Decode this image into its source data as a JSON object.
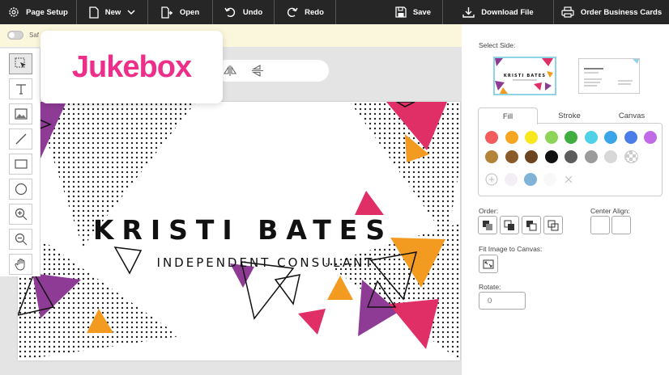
{
  "toolbar": {
    "page_setup": "Page Setup",
    "new": "New",
    "open": "Open",
    "undo": "Undo",
    "redo": "Redo",
    "save": "Save",
    "download": "Download File",
    "order": "Order Business Cards"
  },
  "safe_toggle_label": "Saf",
  "logo": "Jukebox",
  "card": {
    "name": "KRISTI BATES",
    "title": "INDEPENDENT CONSULANT"
  },
  "panel": {
    "select_side": "Select Side:",
    "thumb_name": "KRISTI BATES",
    "tabs": [
      "Fill",
      "Stroke",
      "Canvas"
    ],
    "colors": {
      "row1": [
        "#f25c5c",
        "#f6a623",
        "#f8e71c",
        "#8ed35a",
        "#3fae3f",
        "#4fd1e8",
        "#3aa6e8",
        "#4a7de8",
        "#c06ae8"
      ],
      "row2": [
        "#b38339",
        "#8b5a2b",
        "#6b4420",
        "#111111",
        "#5c5c5c",
        "#9b9b9b",
        "#d8d8d8",
        "#ffffff"
      ],
      "row3_custom": [
        "#f3eef5",
        "#7fb3d8",
        "#f8f8f8"
      ]
    },
    "order_label": "Order:",
    "center_align_label": "Center Align:",
    "fit_label": "Fit Image to Canvas:",
    "rotate_label": "Rotate:",
    "rotate_value": "0"
  }
}
